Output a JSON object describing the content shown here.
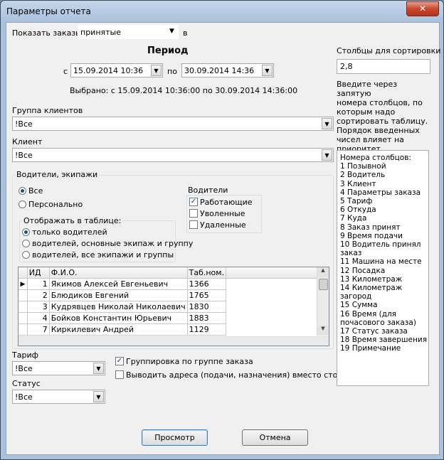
{
  "window": {
    "title": "Параметры отчета",
    "close_symbol": "✕"
  },
  "show_orders": {
    "label": "Показать заказы:",
    "value": "принятые",
    "suffix": "в"
  },
  "period": {
    "heading": "Период",
    "from_label": "с",
    "from_value": "15.09.2014 10:36",
    "to_label": "по",
    "to_value": "30.09.2014 14:36",
    "selected_text": "Выбрано: с 15.09.2014 10:36:00 по 30.09.2014 14:36:00"
  },
  "client_group": {
    "label": "Группа клиентов",
    "value": "!Все"
  },
  "client": {
    "label": "Клиент",
    "value": "!Все"
  },
  "drivers_group": {
    "title": "Водители, экипажи",
    "radio_all": "Все",
    "radio_personal": "Персонально",
    "display": {
      "title": "Отображать в таблице:",
      "opt1": "только водителей",
      "opt2": "водителей, основные экипаж и группу",
      "opt3": "водителей, все экипажи и группы"
    },
    "drivers_box": {
      "title": "Водители",
      "working": "Работающие",
      "fired": "Уволенные",
      "deleted": "Удаленные"
    },
    "table": {
      "columns": [
        "ИД",
        "Ф.И.О.",
        "Таб.ном."
      ],
      "rows": [
        {
          "id": "1",
          "name": "Якимов Алексей Евгеньевич",
          "tab": "1366"
        },
        {
          "id": "2",
          "name": "Блюдиков Евгений",
          "tab": "1765"
        },
        {
          "id": "3",
          "name": "Кудрявцев Николай Николаевич",
          "tab": "1830"
        },
        {
          "id": "4",
          "name": "Бойков Константин Юрьевич",
          "tab": "1883"
        },
        {
          "id": "7",
          "name": "Киркилевич Андрей",
          "tab": "1129"
        }
      ]
    }
  },
  "tariff": {
    "label": "Тариф",
    "value": "!Все"
  },
  "status": {
    "label": "Статус",
    "value": "!Все"
  },
  "options": {
    "group_by": "Группировка по группе заказа",
    "show_addresses": "Выводить адреса (подачи, назначения) вместо стоянок"
  },
  "sort": {
    "label": "Столбцы для сортировки",
    "value": "2,8",
    "hint_lines": [
      "Введите через запятую",
      "номера столбцов, по",
      "которым надо",
      "сортировать таблицу.",
      "Порядок введенных",
      "чисел влияет на",
      "приоритет сортировки."
    ],
    "columns_list": [
      "Номера столбцов:",
      "1  Позывной",
      "2  Водитель",
      "3  Клиент",
      "4  Параметры заказа",
      "5  Тариф",
      "6  Откуда",
      "7  Куда",
      "8  Заказ принят",
      "9  Время подачи",
      "10 Водитель принял",
      "заказ",
      "11 Машина на месте",
      "12 Посадка",
      "13 Километраж",
      "14 Километраж",
      "загород",
      "15 Сумма",
      "16 Время (для",
      "почасового заказа)",
      "17 Статус заказа",
      "18 Время завершения",
      "19 Примечание"
    ]
  },
  "buttons": {
    "preview": "Просмотр",
    "cancel": "Отмена"
  }
}
